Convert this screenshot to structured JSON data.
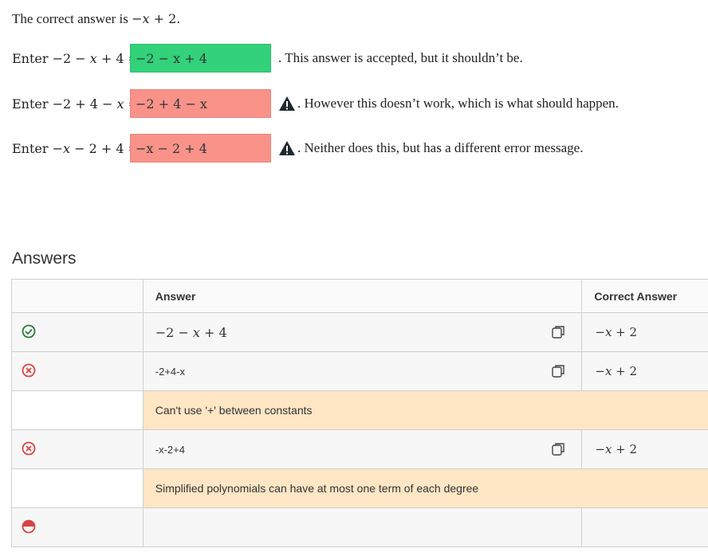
{
  "prompt": {
    "correct_prefix": "The correct answer is",
    "correct_expr": "−𝑥 + 2."
  },
  "questions": [
    {
      "label": "Enter −2 − 𝑥 + 4 =",
      "value": "−2 − x + 4",
      "status": "accepted",
      "comment": ". This answer is accepted, but it shouldn’t be."
    },
    {
      "label": "Enter −2 + 4 − 𝑥 =",
      "value": "−2 + 4 − x",
      "status": "rejected",
      "comment": ". However this doesn’t work, which is what should happen."
    },
    {
      "label": "Enter −𝑥 − 2 + 4 =",
      "value": "−x − 2 + 4",
      "status": "rejected",
      "comment": ". Neither does this, but has a different error message."
    }
  ],
  "answers": {
    "title": "Answers",
    "headers": {
      "icon": "",
      "answer": "Answer",
      "correct": "Correct Answer"
    },
    "rows": [
      {
        "status": "correct",
        "answer": "−2 − 𝑥 + 4",
        "correct": "−𝑥 + 2"
      },
      {
        "status": "wrong",
        "answer": "-2+4-x",
        "correct": "−𝑥 + 2",
        "feedback": "Can't use '+' between constants"
      },
      {
        "status": "wrong",
        "answer": "-x-2+4",
        "correct": "−𝑥 + 2",
        "feedback": "Simplified polynomials can have at most one term of each degree"
      },
      {
        "status": "partial"
      }
    ]
  },
  "colors": {
    "accepted": "#33d17a",
    "rejected": "#f9938a",
    "feedback": "#ffe6c5",
    "correct_icon": "#2d7a3a",
    "wrong_icon": "#d64545"
  }
}
